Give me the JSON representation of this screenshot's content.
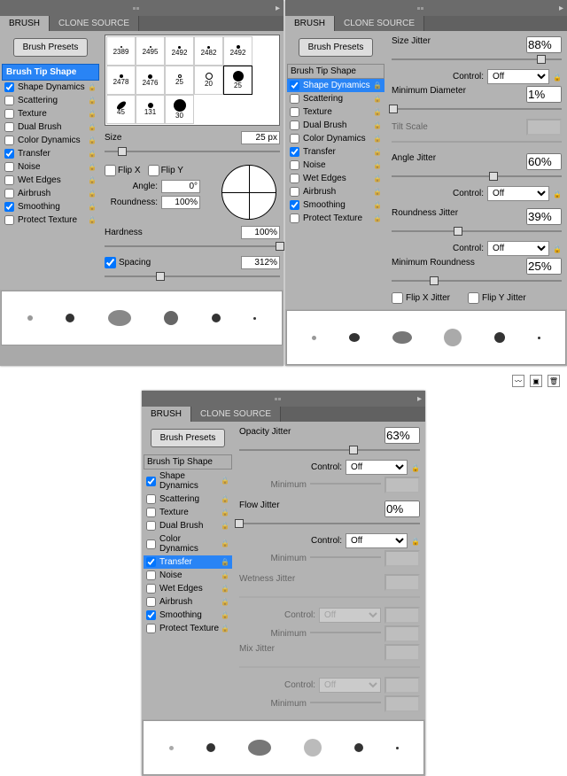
{
  "tabs": {
    "brush": "BRUSH",
    "clone": "CLONE SOURCE"
  },
  "presets_btn": "Brush Presets",
  "sidebar": {
    "tip": "Brush Tip Shape",
    "items": [
      {
        "label": "Shape Dynamics"
      },
      {
        "label": "Scattering"
      },
      {
        "label": "Texture"
      },
      {
        "label": "Dual Brush"
      },
      {
        "label": "Color Dynamics"
      },
      {
        "label": "Transfer"
      },
      {
        "label": "Noise"
      },
      {
        "label": "Wet Edges"
      },
      {
        "label": "Airbrush"
      },
      {
        "label": "Smoothing"
      },
      {
        "label": "Protect Texture"
      }
    ]
  },
  "left": {
    "brush_cells": [
      "2389",
      "2495",
      "2492",
      "2482",
      "2492",
      "2478",
      "2476",
      "25",
      "20",
      "25",
      "45",
      "131",
      "30"
    ],
    "size_lbl": "Size",
    "size_val": "25 px",
    "flipx": "Flip X",
    "flipy": "Flip Y",
    "angle_lbl": "Angle:",
    "angle_val": "0°",
    "round_lbl": "Roundness:",
    "round_val": "100%",
    "hard_lbl": "Hardness",
    "hard_val": "100%",
    "spacing_lbl": "Spacing",
    "spacing_val": "312%"
  },
  "right": {
    "size_jitter": "Size Jitter",
    "size_jitter_val": "88%",
    "control": "Control:",
    "off": "Off",
    "min_diam": "Minimum Diameter",
    "min_diam_val": "1%",
    "tilt": "Tilt Scale",
    "angle_jitter": "Angle Jitter",
    "angle_jitter_val": "60%",
    "round_jitter": "Roundness Jitter",
    "round_jitter_val": "39%",
    "min_round": "Minimum Roundness",
    "min_round_val": "25%",
    "flipxj": "Flip X Jitter",
    "flipyj": "Flip Y Jitter"
  },
  "bottom": {
    "opac_jitter": "Opacity Jitter",
    "opac_val": "63%",
    "flow_jitter": "Flow Jitter",
    "flow_val": "0%",
    "control": "Control:",
    "off": "Off",
    "minimum": "Minimum",
    "wet_jitter": "Wetness Jitter",
    "mix_jitter": "Mix Jitter"
  }
}
